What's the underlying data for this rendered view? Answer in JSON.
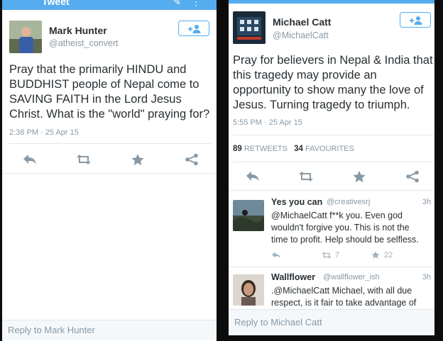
{
  "left": {
    "topbar_title": "Tweet",
    "user": {
      "name": "Mark Hunter",
      "handle": "@atheist_convert"
    },
    "tweet_lines": [
      "Pray that the primarily HINDU and",
      "BUDDHIST people of Nepal come to",
      "SAVING FAITH in the Lord Jesus",
      "Christ. What is the \"world\" praying for?"
    ],
    "timestamp": "2:38 PM · 25 Apr 15",
    "actions": [
      "reply-icon",
      "retweet-icon",
      "favorite-icon",
      "share-icon"
    ],
    "reply_placeholder": "Reply to Mark Hunter"
  },
  "right": {
    "user": {
      "name": "Michael Catt",
      "handle": "@MichaelCatt"
    },
    "tweet_lines": [
      "Pray for believers in Nepal & India that",
      "this tragedy may provide an",
      "opportunity to show many the love of",
      "Jesus. Turning tragedy to triumph."
    ],
    "timestamp": "5:55 PM · 25 Apr 15",
    "retweets": {
      "count": "89",
      "label": "RETWEETS"
    },
    "favourites": {
      "count": "34",
      "label": "FAVOURITES"
    },
    "actions": [
      "reply-icon",
      "retweet-icon",
      "favorite-icon",
      "share-icon"
    ],
    "replies": [
      {
        "name": "Yes you can",
        "handle": "@creativesrj",
        "time": "3h",
        "lines": [
          "@MichaelCatt f**k you. Even god",
          "wouldn't forgive you. This is not the",
          "time to profit. Help should be selfless."
        ],
        "retweets": "7",
        "favorites": "22"
      },
      {
        "name": "Wallflower",
        "handle": "@wallflower_ish",
        "time": "3h",
        "lines": [
          ".@MichaelCatt Michael, with all due",
          "respect, is it fair to take advantage of"
        ]
      }
    ],
    "reply_placeholder": "Reply to Michael Catt"
  },
  "colors": {
    "brand": "#55acee",
    "text": "#292f33",
    "muted": "#8899a6",
    "divider": "#e1e8ed"
  }
}
